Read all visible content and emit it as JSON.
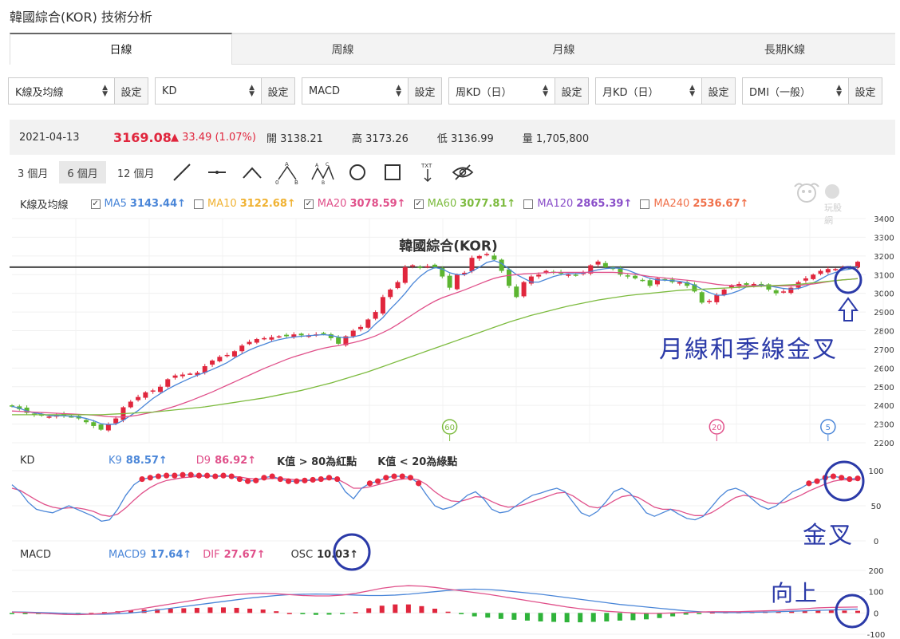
{
  "page": {
    "title": "韓國綜合(KOR) 技術分析"
  },
  "tabs": [
    {
      "label": "日線",
      "active": true
    },
    {
      "label": "周線",
      "active": false
    },
    {
      "label": "月線",
      "active": false
    },
    {
      "label": "長期K線",
      "active": false
    }
  ],
  "selectors": [
    {
      "value": "K線及均線",
      "button": "設定"
    },
    {
      "value": "KD",
      "button": "設定"
    },
    {
      "value": "MACD",
      "button": "設定"
    },
    {
      "value": "周KD（日）",
      "button": "設定"
    },
    {
      "value": "月KD（日）",
      "button": "設定"
    },
    {
      "value": "DMI（一般）",
      "button": "設定"
    }
  ],
  "quote": {
    "date": "2021-04-13",
    "price": "3169.08",
    "change": "▲ 33.49 (1.07%)",
    "open_label": "開",
    "open": "3138.21",
    "high_label": "高",
    "high": "3173.26",
    "low_label": "低",
    "low": "3136.99",
    "vol_label": "量",
    "vol": "1,705,800"
  },
  "ranges": [
    "3 個月",
    "6 個月",
    "12 個月"
  ],
  "active_range": "6 個月",
  "tools": [
    "line-tool-icon",
    "segment-tool-icon",
    "angle-tool-icon",
    "abc-pattern-icon",
    "abcd-pattern-icon",
    "circle-tool-icon",
    "rectangle-tool-icon",
    "text-tool-icon",
    "hide-drawings-icon"
  ],
  "ma_legend": {
    "title": "K線及均線",
    "items": [
      {
        "label": "MA5",
        "value": "3143.44↑",
        "checked": true,
        "color": "#4a86d8"
      },
      {
        "label": "MA10",
        "value": "3122.68↑",
        "checked": false,
        "color": "#f0b232"
      },
      {
        "label": "MA20",
        "value": "3078.59↑",
        "checked": true,
        "color": "#e0508a"
      },
      {
        "label": "MA60",
        "value": "3077.81↑",
        "checked": true,
        "color": "#7dbb3f"
      },
      {
        "label": "MA120",
        "value": "2865.39↑",
        "checked": false,
        "color": "#8a4fc9"
      },
      {
        "label": "MA240",
        "value": "2536.67↑",
        "checked": false,
        "color": "#f0704a"
      }
    ]
  },
  "logo_text": "玩股網",
  "chart_data": [
    {
      "type": "candlestick",
      "title": "韓國綜合(KOR)",
      "ylim": [
        2200,
        3400
      ],
      "yticks": [
        "3400",
        "3300",
        "3200",
        "3100",
        "3000",
        "2900",
        "2800",
        "2700",
        "2600",
        "2500",
        "2400",
        "2300",
        "2200"
      ],
      "reference_line": 3140,
      "closes": [
        2395,
        2380,
        2360,
        2350,
        2345,
        2340,
        2350,
        2345,
        2340,
        2330,
        2310,
        2290,
        2270,
        2300,
        2330,
        2390,
        2420,
        2445,
        2470,
        2480,
        2500,
        2540,
        2560,
        2565,
        2570,
        2575,
        2610,
        2640,
        2660,
        2670,
        2690,
        2720,
        2740,
        2755,
        2760,
        2765,
        2770,
        2770,
        2780,
        2775,
        2775,
        2780,
        2785,
        2760,
        2730,
        2770,
        2800,
        2820,
        2860,
        2900,
        2980,
        3020,
        3060,
        3140,
        3150,
        3140,
        3145,
        3140,
        3090,
        3030,
        3100,
        3110,
        3190,
        3200,
        3210,
        3180,
        3120,
        3040,
        2980,
        3060,
        3090,
        3100,
        3120,
        3110,
        3105,
        3100,
        3095,
        3110,
        3150,
        3170,
        3140,
        3130,
        3100,
        3090,
        3080,
        3070,
        3040,
        3080,
        3070,
        3060,
        3060,
        3040,
        3010,
        2950,
        2960,
        2990,
        3020,
        3040,
        3050,
        3045,
        3050,
        3040,
        3020,
        3000,
        3010,
        3030,
        3060,
        3080,
        3100,
        3120,
        3130,
        3130,
        3140,
        3135,
        3169
      ],
      "series": [
        {
          "name": "MA5",
          "values": [
            2395,
            2385,
            2370,
            2360,
            2354,
            2345,
            2345,
            2344,
            2342,
            2338,
            2330,
            2318,
            2302,
            2298,
            2300,
            2320,
            2346,
            2372,
            2405,
            2437,
            2463,
            2487,
            2508,
            2527,
            2545,
            2562,
            2576,
            2592,
            2610,
            2629,
            2654,
            2676,
            2696,
            2713,
            2727,
            2742,
            2752,
            2760,
            2766,
            2770,
            2773,
            2776,
            2779,
            2775,
            2766,
            2762,
            2767,
            2776,
            2796,
            2836,
            2870,
            2916,
            2956,
            3000,
            3050,
            3090,
            3120,
            3138,
            3130,
            3110,
            3100,
            3100,
            3118,
            3140,
            3165,
            3175,
            3160,
            3130,
            3100,
            3080,
            3060,
            3060,
            3075,
            3090,
            3100,
            3105,
            3106,
            3108,
            3116,
            3126,
            3132,
            3136,
            3134,
            3124,
            3108,
            3094,
            3080,
            3072,
            3070,
            3068,
            3064,
            3056,
            3044,
            3022,
            3004,
            2990,
            2990,
            3000,
            3014,
            3034,
            3040,
            3044,
            3040,
            3033,
            3026,
            3022,
            3026,
            3038,
            3056,
            3076,
            3098,
            3112,
            3124,
            3130,
            3143
          ]
        },
        {
          "name": "MA20",
          "values": [
            2370,
            2368,
            2366,
            2364,
            2362,
            2360,
            2358,
            2356,
            2354,
            2352,
            2350,
            2348,
            2344,
            2340,
            2338,
            2338,
            2342,
            2348,
            2356,
            2364,
            2372,
            2384,
            2396,
            2410,
            2424,
            2440,
            2456,
            2472,
            2490,
            2508,
            2526,
            2544,
            2562,
            2580,
            2598,
            2614,
            2630,
            2646,
            2660,
            2672,
            2684,
            2696,
            2706,
            2714,
            2720,
            2728,
            2736,
            2746,
            2758,
            2772,
            2790,
            2810,
            2834,
            2860,
            2886,
            2912,
            2936,
            2958,
            2976,
            2990,
            3004,
            3018,
            3034,
            3050,
            3066,
            3080,
            3090,
            3096,
            3100,
            3104,
            3106,
            3108,
            3110,
            3112,
            3112,
            3112,
            3112,
            3112,
            3112,
            3112,
            3112,
            3112,
            3110,
            3106,
            3102,
            3096,
            3090,
            3086,
            3082,
            3078,
            3074,
            3070,
            3066,
            3060,
            3054,
            3048,
            3044,
            3042,
            3040,
            3040,
            3040,
            3040,
            3040,
            3040,
            3040,
            3040,
            3042,
            3046,
            3050,
            3056,
            3062,
            3068,
            3072,
            3075,
            3079
          ]
        },
        {
          "name": "MA60",
          "values": [
            2350,
            2350,
            2350,
            2350,
            2350,
            2350,
            2350,
            2350,
            2350,
            2350,
            2350,
            2350,
            2350,
            2352,
            2354,
            2356,
            2358,
            2360,
            2362,
            2364,
            2368,
            2372,
            2376,
            2380,
            2384,
            2388,
            2392,
            2398,
            2404,
            2410,
            2416,
            2422,
            2428,
            2434,
            2440,
            2448,
            2456,
            2464,
            2472,
            2480,
            2490,
            2500,
            2510,
            2520,
            2532,
            2544,
            2556,
            2568,
            2580,
            2594,
            2608,
            2622,
            2636,
            2650,
            2664,
            2678,
            2692,
            2706,
            2720,
            2734,
            2748,
            2762,
            2776,
            2790,
            2804,
            2818,
            2832,
            2846,
            2858,
            2870,
            2882,
            2892,
            2902,
            2912,
            2922,
            2932,
            2940,
            2948,
            2956,
            2964,
            2970,
            2976,
            2982,
            2988,
            2992,
            2996,
            3000,
            3004,
            3008,
            3012,
            3016,
            3018,
            3020,
            3022,
            3024,
            3026,
            3028,
            3030,
            3032,
            3034,
            3036,
            3038,
            3040,
            3042,
            3044,
            3046,
            3048,
            3052,
            3056,
            3060,
            3064,
            3068,
            3072,
            3075,
            3078
          ]
        }
      ],
      "markers": [
        {
          "label": "60",
          "color": "#7dbb3f"
        },
        {
          "label": "20",
          "color": "#e0508a"
        },
        {
          "label": "5",
          "color": "#4a86d8"
        }
      ]
    },
    {
      "type": "line",
      "title": "KD",
      "ylim": [
        0,
        100
      ],
      "yticks": [
        "100",
        "50",
        "0"
      ],
      "labels": {
        "k": "K9",
        "k_value": "88.57↑",
        "d": "D9",
        "d_value": "86.92↑",
        "note1": "K值 > 80為紅點",
        "note2": "K值 < 20為綠點"
      },
      "series": [
        {
          "name": "K9",
          "values": [
            80,
            70,
            55,
            45,
            42,
            40,
            45,
            50,
            45,
            40,
            35,
            28,
            30,
            45,
            65,
            80,
            88,
            90,
            92,
            93,
            93,
            94,
            94,
            93,
            93,
            92,
            93,
            92,
            88,
            85,
            86,
            90,
            92,
            88,
            85,
            85,
            86,
            87,
            88,
            90,
            88,
            70,
            60,
            75,
            82,
            85,
            90,
            92,
            92,
            90,
            82,
            65,
            50,
            45,
            48,
            55,
            65,
            70,
            60,
            45,
            40,
            42,
            50,
            58,
            65,
            68,
            72,
            75,
            70,
            55,
            40,
            35,
            42,
            55,
            70,
            75,
            68,
            55,
            40,
            35,
            40,
            45,
            38,
            32,
            30,
            35,
            48,
            62,
            72,
            75,
            70,
            60,
            50,
            45,
            50,
            60,
            70,
            75,
            82,
            85,
            90,
            92,
            90,
            88,
            89
          ]
        },
        {
          "name": "D9",
          "values": [
            75,
            72,
            65,
            58,
            52,
            48,
            46,
            47,
            47,
            45,
            42,
            37,
            35,
            38,
            47,
            58,
            68,
            76,
            82,
            86,
            88,
            90,
            91,
            92,
            92,
            92,
            92,
            92,
            91,
            89,
            88,
            88,
            89,
            89,
            88,
            87,
            86,
            86,
            87,
            88,
            88,
            82,
            75,
            75,
            77,
            80,
            83,
            86,
            88,
            89,
            87,
            80,
            70,
            62,
            57,
            56,
            59,
            63,
            62,
            56,
            51,
            48,
            49,
            52,
            56,
            60,
            64,
            68,
            69,
            64,
            56,
            49,
            47,
            50,
            57,
            63,
            65,
            62,
            55,
            48,
            45,
            45,
            43,
            39,
            36,
            36,
            40,
            47,
            55,
            62,
            65,
            63,
            59,
            54,
            53,
            55,
            60,
            65,
            71,
            76,
            81,
            85,
            87,
            87,
            87
          ]
        }
      ]
    },
    {
      "type": "line",
      "title": "MACD",
      "ylim": [
        -100,
        200
      ],
      "yticks": [
        "200",
        "100",
        "0",
        "-100"
      ],
      "labels": {
        "macd": "MACD9",
        "macd_value": "17.64↑",
        "dif": "DIF",
        "dif_value": "27.67↑",
        "osc": "OSC",
        "osc_value": "10.03↑"
      },
      "series": [
        {
          "name": "MACD9",
          "values": [
            5,
            4,
            2,
            0,
            -2,
            -4,
            -6,
            -6,
            -4,
            0,
            6,
            14,
            22,
            30,
            38,
            46,
            54,
            62,
            70,
            76,
            82,
            86,
            88,
            89,
            88,
            86,
            84,
            82,
            82,
            84,
            88,
            94,
            100,
            106,
            110,
            112,
            110,
            106,
            100,
            94,
            88,
            80,
            72,
            64,
            56,
            48,
            40,
            34,
            28,
            22,
            16,
            10,
            6,
            3,
            2,
            2,
            3,
            4,
            6,
            8,
            10,
            12,
            14,
            16,
            18
          ]
        },
        {
          "name": "DIF",
          "values": [
            4,
            2,
            -1,
            -4,
            -7,
            -8,
            -6,
            -2,
            4,
            12,
            22,
            32,
            42,
            52,
            62,
            72,
            80,
            86,
            90,
            92,
            90,
            86,
            82,
            80,
            80,
            84,
            92,
            104,
            116,
            124,
            128,
            126,
            120,
            112,
            104,
            96,
            88,
            78,
            68,
            58,
            48,
            38,
            28,
            20,
            14,
            8,
            4,
            0,
            -2,
            -2,
            0,
            2,
            4,
            6,
            6,
            6,
            8,
            10,
            12,
            16,
            20,
            24,
            26,
            27,
            28
          ]
        }
      ],
      "osc": [
        -1,
        -2,
        -3,
        -4,
        -5,
        -4,
        0,
        4,
        8,
        12,
        16,
        18,
        20,
        22,
        24,
        26,
        26,
        24,
        20,
        16,
        8,
        0,
        -6,
        -9,
        -8,
        -2,
        4,
        22,
        34,
        40,
        40,
        32,
        20,
        6,
        -6,
        -16,
        -22,
        -28,
        -32,
        -36,
        -40,
        -42,
        -44,
        -44,
        -42,
        -40,
        -36,
        -34,
        -30,
        -24,
        -16,
        -8,
        -2,
        3,
        4,
        4,
        5,
        6,
        6,
        8,
        10,
        12,
        12,
        11,
        10
      ]
    }
  ],
  "annotations": {
    "main": "月線和季線金叉",
    "kd": "金叉",
    "macd": "向上"
  }
}
